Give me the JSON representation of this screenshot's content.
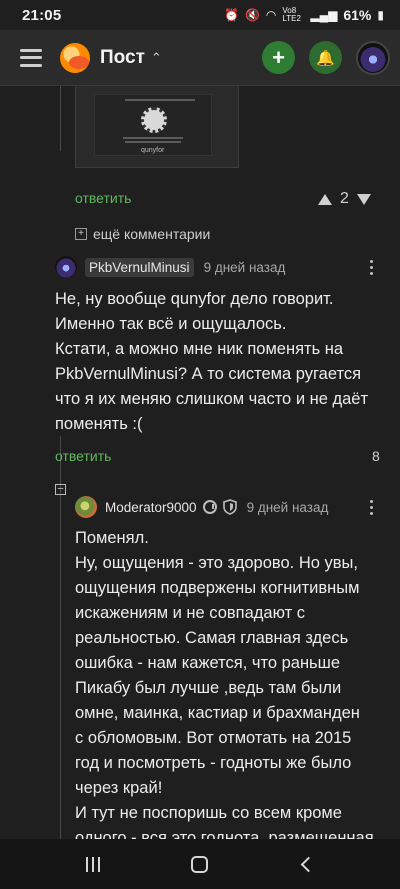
{
  "status": {
    "time": "21:05",
    "network": "Vo8 LTE2",
    "battery": "61%"
  },
  "appbar": {
    "title": "Пост",
    "add_label": "+",
    "icons": [
      "menu-icon",
      "pikabu-logo",
      "chevron-up-icon",
      "plus-icon",
      "bell-icon",
      "avatar"
    ]
  },
  "prev_comment": {
    "reply_label": "ответить",
    "rating": "2",
    "image_caption": "qunyfor"
  },
  "more_comments_label": "ещё комментарии",
  "comment1": {
    "author": "PkbVernulMinusi",
    "time": "9 дней назад",
    "lines": [
      "Не, ну вообще qunyfor дело говорит.",
      "Именно так всё и ощущалось.",
      "Кстати, а можно мне ник поменять на",
      "PkbVernulMinusi? А то система ругается",
      "что я их меняю слишком часто и не даёт",
      "поменять :("
    ],
    "reply_label": "ответить",
    "rating": "8"
  },
  "comment2": {
    "author": "Moderator9000",
    "time": "9 дней назад",
    "lines": [
      "Поменял.",
      "Ну, ощущения - это здорово. Но увы,",
      "ощущения подвержены когнитивным",
      "искажениям и не совпадают с",
      "реальностью. Самая главная здесь",
      "ошибка - нам кажется, что раньше",
      "Пикабу был лучше ,ведь там были",
      "омне, маинка, кастиар и брахманден",
      "с обломовым. Вот отмотать на 2015",
      "год и посмотреть - годноты же было",
      "через край!",
      "И тут не поспоришь со всем кроме",
      "одного - вся это годнота, размещенная"
    ]
  },
  "colors": {
    "accent": "#5fb85f",
    "button_green": "#2e7d32",
    "background": "#1f1f1f"
  }
}
